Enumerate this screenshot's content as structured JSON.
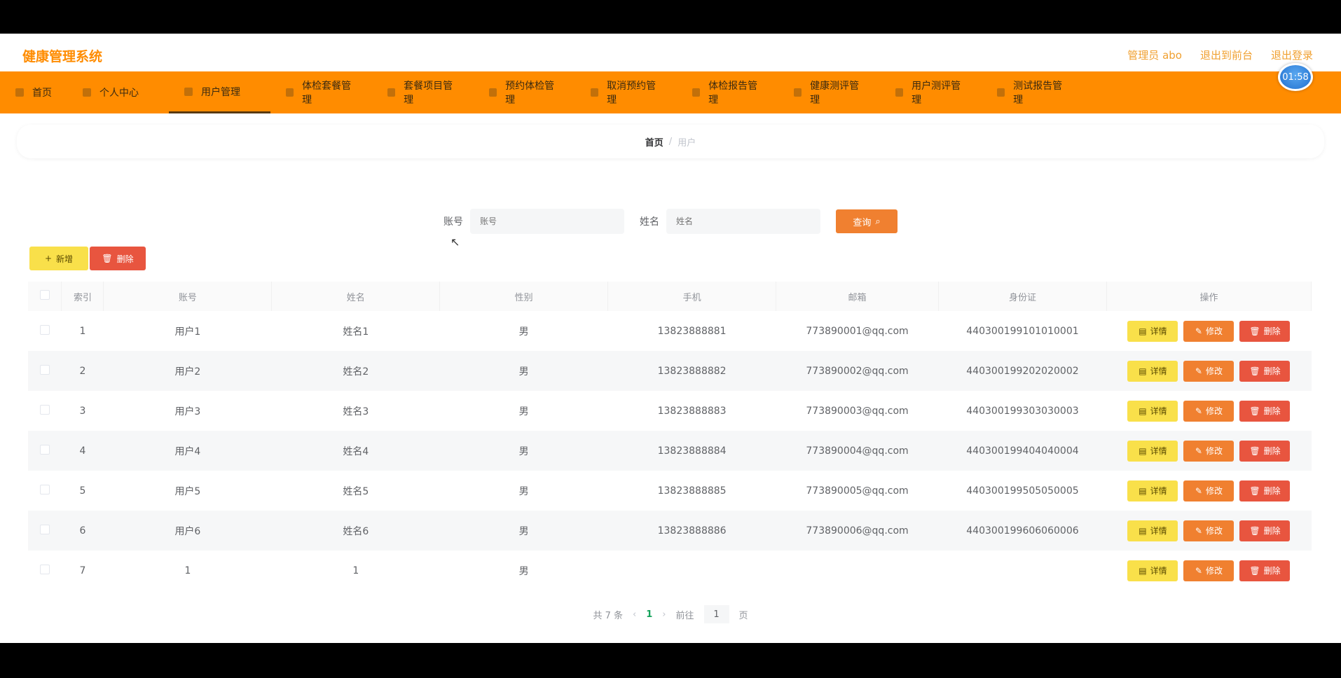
{
  "app": {
    "title": "健康管理系统"
  },
  "top_links": [
    "管理员 abo",
    "退出到前台",
    "退出登录"
  ],
  "clock": "01:58",
  "nav": [
    {
      "label": "首页",
      "active": false
    },
    {
      "label": "个人中心",
      "active": false
    },
    {
      "label": "用户管理",
      "active": true
    },
    {
      "label": "体检套餐管理",
      "active": false
    },
    {
      "label": "套餐项目管理",
      "active": false
    },
    {
      "label": "预约体检管理",
      "active": false
    },
    {
      "label": "取消预约管理",
      "active": false
    },
    {
      "label": "体检报告管理",
      "active": false
    },
    {
      "label": "健康测评管理",
      "active": false
    },
    {
      "label": "用户测评管理",
      "active": false
    },
    {
      "label": "测试报告管理",
      "active": false
    }
  ],
  "breadcrumb": {
    "home": "首页",
    "sep": "/",
    "current": "用户"
  },
  "search": {
    "account_label": "账号",
    "account_placeholder": "账号",
    "name_label": "姓名",
    "name_placeholder": "姓名",
    "query_label": "查询"
  },
  "actions": {
    "add_label": "新增",
    "delete_label": "删除"
  },
  "table": {
    "headers": [
      "索引",
      "账号",
      "姓名",
      "性别",
      "手机",
      "邮箱",
      "身份证",
      "操作"
    ],
    "rows": [
      {
        "index": "1",
        "account": "用户1",
        "name": "姓名1",
        "gender": "男",
        "phone": "13823888881",
        "email": "773890001@qq.com",
        "id_card": "440300199101010001"
      },
      {
        "index": "2",
        "account": "用户2",
        "name": "姓名2",
        "gender": "男",
        "phone": "13823888882",
        "email": "773890002@qq.com",
        "id_card": "440300199202020002"
      },
      {
        "index": "3",
        "account": "用户3",
        "name": "姓名3",
        "gender": "男",
        "phone": "13823888883",
        "email": "773890003@qq.com",
        "id_card": "440300199303030003"
      },
      {
        "index": "4",
        "account": "用户4",
        "name": "姓名4",
        "gender": "男",
        "phone": "13823888884",
        "email": "773890004@qq.com",
        "id_card": "440300199404040004"
      },
      {
        "index": "5",
        "account": "用户5",
        "name": "姓名5",
        "gender": "男",
        "phone": "13823888885",
        "email": "773890005@qq.com",
        "id_card": "440300199505050005"
      },
      {
        "index": "6",
        "account": "用户6",
        "name": "姓名6",
        "gender": "男",
        "phone": "13823888886",
        "email": "773890006@qq.com",
        "id_card": "440300199606060006"
      },
      {
        "index": "7",
        "account": "1",
        "name": "1",
        "gender": "男",
        "phone": "",
        "email": "",
        "id_card": ""
      }
    ],
    "row_ops": {
      "detail": "详情",
      "edit": "修改",
      "delete": "删除"
    }
  },
  "pager": {
    "total": "共 7 条",
    "prev": "‹",
    "current": "1",
    "next": "›",
    "goto": "前往",
    "goto_value": "1",
    "page_suffix": "页"
  },
  "colors": {
    "nav_bg": "#ff8c00",
    "brand": "#ff8c00",
    "btn_yellow": "#f9e04a",
    "btn_orange": "#f08030",
    "btn_red": "#e8553f",
    "page_active": "#16a35c"
  }
}
